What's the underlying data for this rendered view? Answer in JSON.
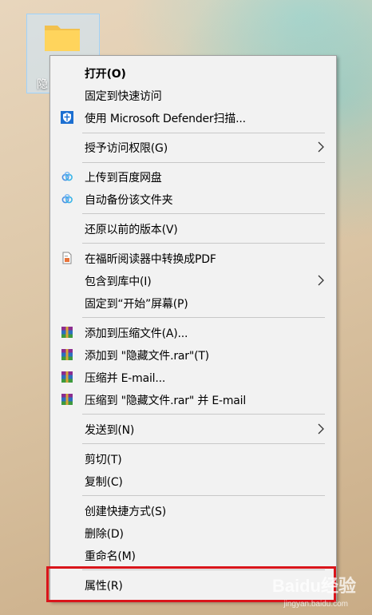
{
  "desktop": {
    "folder_label": "隐"
  },
  "menu": {
    "items": [
      {
        "label": "打开(O)",
        "icon": "",
        "bold": true
      },
      {
        "label": "固定到快速访问",
        "icon": ""
      },
      {
        "label": "使用 Microsoft Defender扫描...",
        "icon": "defender-shield-icon"
      },
      {
        "label": "授予访问权限(G)",
        "icon": "",
        "submenu": true
      },
      {
        "label": "上传到百度网盘",
        "icon": "baidu-netdisk-icon"
      },
      {
        "label": "自动备份该文件夹",
        "icon": "baidu-netdisk-icon"
      },
      {
        "label": "还原以前的版本(V)",
        "icon": ""
      },
      {
        "label": "在福昕阅读器中转换成PDF",
        "icon": "foxit-pdf-icon"
      },
      {
        "label": "包含到库中(I)",
        "icon": "",
        "submenu": true
      },
      {
        "label": "固定到“开始”屏幕(P)",
        "icon": ""
      },
      {
        "label": "添加到压缩文件(A)...",
        "icon": "winrar-icon"
      },
      {
        "label": "添加到 \"隐藏文件.rar\"(T)",
        "icon": "winrar-icon"
      },
      {
        "label": "压缩并 E-mail...",
        "icon": "winrar-icon"
      },
      {
        "label": "压缩到 \"隐藏文件.rar\" 并 E-mail",
        "icon": "winrar-icon"
      },
      {
        "label": "发送到(N)",
        "icon": "",
        "submenu": true
      },
      {
        "label": "剪切(T)",
        "icon": ""
      },
      {
        "label": "复制(C)",
        "icon": ""
      },
      {
        "label": "创建快捷方式(S)",
        "icon": ""
      },
      {
        "label": "删除(D)",
        "icon": ""
      },
      {
        "label": "重命名(M)",
        "icon": ""
      },
      {
        "label": "属性(R)",
        "icon": ""
      }
    ]
  },
  "colors": {
    "menu_bg": "#f2f2f2",
    "highlight_border": "#d9151b",
    "defender_blue": "#1c6fd1"
  },
  "watermark": {
    "text": "Baidu经验",
    "sub": "jingyan.baidu.com"
  }
}
